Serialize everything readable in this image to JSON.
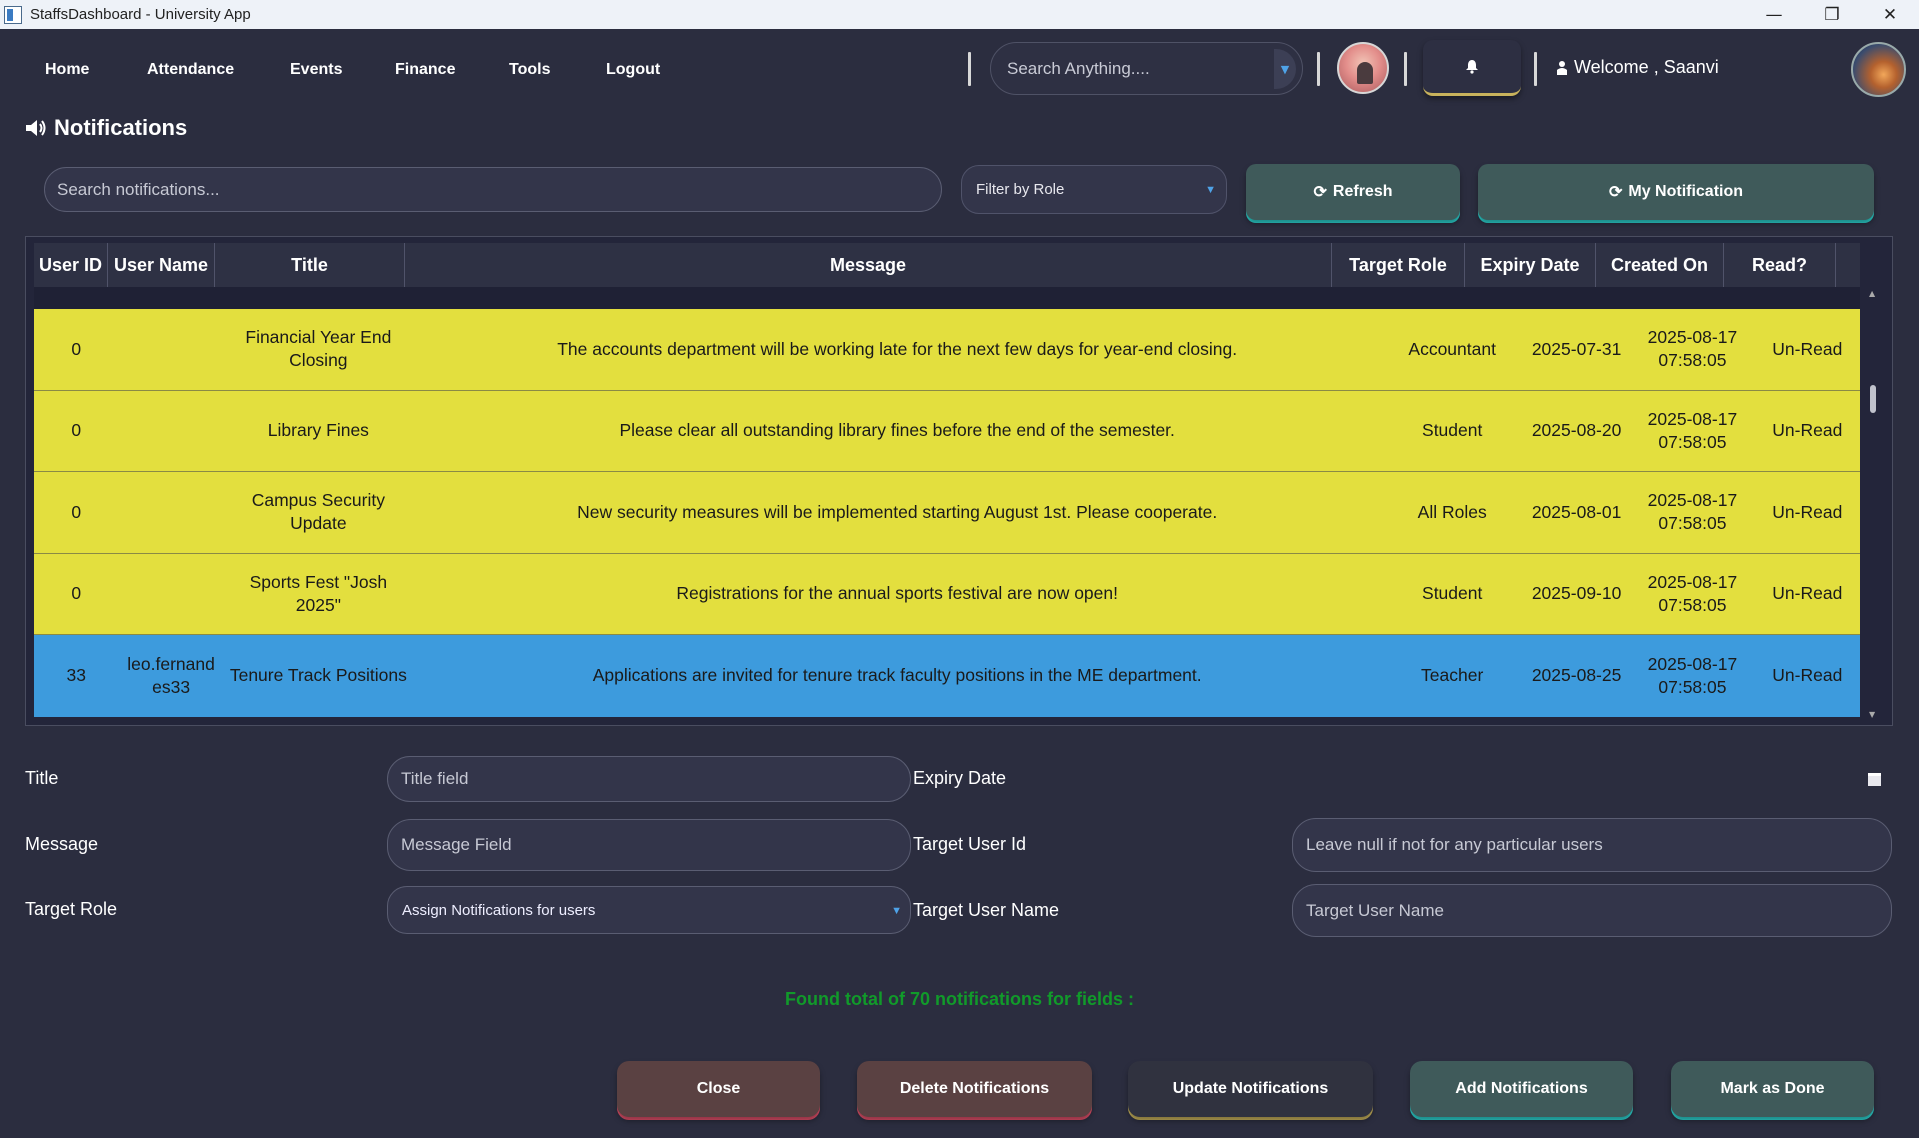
{
  "window": {
    "title": "StaffsDashboard - University App",
    "minimize": "—",
    "maximize": "❐",
    "close": "✕"
  },
  "nav": {
    "items": [
      "Home",
      "Attendance",
      "Events",
      "Finance",
      "Tools",
      "Logout"
    ]
  },
  "header": {
    "search_placeholder": "Search Anything....",
    "bell_icon": "bell-icon",
    "welcome_text": "Welcome , Saanvi"
  },
  "page": {
    "title": "Notifications",
    "title_icon": "speaker-icon"
  },
  "toolbar": {
    "search_placeholder": "Search notifications...",
    "role_filter": "Filter by Role",
    "refresh_label": "Refresh",
    "my_notification_label": "My Notification"
  },
  "table": {
    "headers": [
      "User ID",
      "User Name",
      "Title",
      "Message",
      "Target Role",
      "Expiry Date",
      "Created On",
      "Read?"
    ],
    "rows": [
      {
        "user_id": "0",
        "user_name": "",
        "title": "Financial Year End Closing",
        "message": "The accounts department will be working late for the next few days for year-end closing.",
        "target_role": "Accountant",
        "expiry_date": "2025-07-31",
        "created_on": "2025-08-17 07:58:05",
        "read": "Un-Read"
      },
      {
        "user_id": "0",
        "user_name": "",
        "title": "Library Fines",
        "message": "Please clear all outstanding library fines before the end of the semester.",
        "target_role": "Student",
        "expiry_date": "2025-08-20",
        "created_on": "2025-08-17 07:58:05",
        "read": "Un-Read"
      },
      {
        "user_id": "0",
        "user_name": "",
        "title": "Campus Security Update",
        "message": "New security measures will be implemented starting August 1st. Please cooperate.",
        "target_role": "All Roles",
        "expiry_date": "2025-08-01",
        "created_on": "2025-08-17 07:58:05",
        "read": "Un-Read"
      },
      {
        "user_id": "0",
        "user_name": "",
        "title": "Sports Fest \"Josh 2025\"",
        "message": "Registrations for the annual sports festival are now open!",
        "target_role": "Student",
        "expiry_date": "2025-09-10",
        "created_on": "2025-08-17 07:58:05",
        "read": "Un-Read"
      },
      {
        "user_id": "33",
        "user_name": "leo.fernandes33",
        "title": "Tenure Track Positions",
        "message": "Applications are invited for tenure track faculty positions in the ME department.",
        "target_role": "Teacher",
        "expiry_date": "2025-08-25",
        "created_on": "2025-08-17 07:58:05",
        "read": "Un-Read"
      }
    ]
  },
  "form": {
    "title_label": "Title",
    "title_placeholder": "Title field",
    "message_label": "Message",
    "message_placeholder": "Message Field",
    "target_role_label": "Target Role",
    "target_role_value": "Assign Notifications for users",
    "expiry_label": "Expiry Date",
    "target_user_id_label": "Target User Id",
    "target_user_id_placeholder": "Leave null if not for any particular users",
    "target_user_name_label": "Target User Name",
    "target_user_name_placeholder": "Target User Name"
  },
  "status_text": "Found total of 70 notifications for fields :",
  "actions": {
    "close": "Close",
    "delete": "Delete Notifications",
    "update": "Update Notifications",
    "add": "Add Notifications",
    "mark_done": "Mark as Done"
  },
  "colors": {
    "background": "#2b2d3f",
    "row_highlight": "#e3df3e",
    "row_selected": "#3d9bdd",
    "status_green": "#119a2a",
    "accent_teal": "#2dd3d0"
  }
}
